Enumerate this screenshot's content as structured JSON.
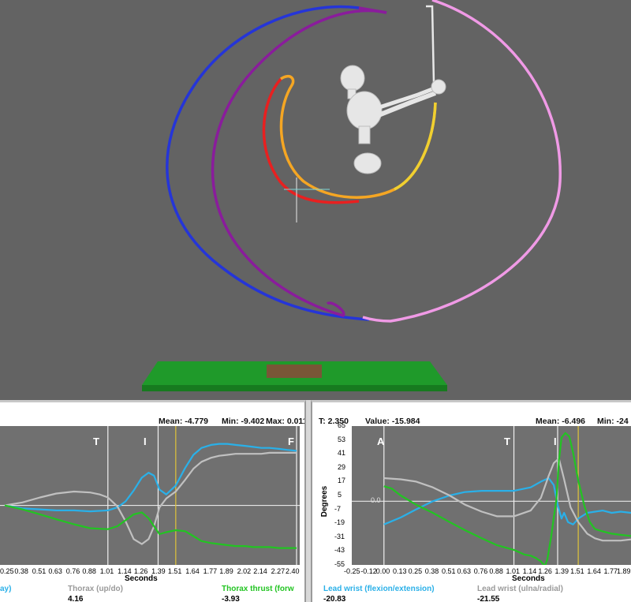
{
  "scene": {
    "colors": {
      "background": "#636363",
      "blue": "#2535d8",
      "purple": "#8a1c9c",
      "pink": "#f09ae6",
      "red": "#e82020",
      "orange": "#f5a623",
      "yellow": "#f0d030",
      "mat": "#1f9a2a"
    }
  },
  "left_panel": {
    "stats": {
      "mean": "Mean: -4.779",
      "min": "Min: -9.402",
      "max": "Max: 0.011"
    },
    "event_labels": [
      "T",
      "I",
      "F"
    ],
    "legend": [
      {
        "label": "ay)",
        "value": "",
        "color": "#2ab0e8"
      },
      {
        "label": "Thorax (up/do)",
        "value": "4.16",
        "color": "#9a9a9a"
      },
      {
        "label": "Thorax thrust (forw",
        "value": "-3.93",
        "color": "#22c422"
      }
    ]
  },
  "right_panel": {
    "header": {
      "time": "T: 2.350",
      "value": "Value: -15.984",
      "mean": "Mean: -6.496",
      "min": "Min: -24"
    },
    "event_labels": [
      "A",
      "T",
      "I"
    ],
    "zero_label": "0.0",
    "legend": [
      {
        "label": "Lead wrist (flexion/extension)",
        "value": "-20.83",
        "color": "#2ab0e8"
      },
      {
        "label": "Lead wrist (ulna/radial)",
        "value": "-21.55",
        "color": "#9a9a9a"
      }
    ]
  },
  "chart_data": [
    {
      "type": "line",
      "title": "",
      "xlabel": "Seconds",
      "ylabel": "",
      "x_ticks": [
        "0.25",
        "0.38",
        "0.51",
        "0.63",
        "0.76",
        "0.88",
        "1.01",
        "1.14",
        "1.26",
        "1.39",
        "1.51",
        "1.64",
        "1.77",
        "1.89",
        "2.02",
        "2.14",
        "2.27",
        "2.40"
      ],
      "xlim": [
        0.25,
        2.4
      ],
      "ylim": [
        -12,
        2
      ],
      "events": [
        {
          "label": "T",
          "x": 1.01
        },
        {
          "label": "I",
          "x": 1.38
        },
        {
          "label": "F",
          "x": 2.4
        }
      ],
      "cursor_x": 1.51,
      "series": [
        {
          "name": "",
          "color": "#2ab0e8",
          "x": [
            0.25,
            0.38,
            0.51,
            0.63,
            0.76,
            0.88,
            1.01,
            1.08,
            1.14,
            1.2,
            1.26,
            1.31,
            1.35,
            1.39,
            1.44,
            1.51,
            1.58,
            1.64,
            1.7,
            1.77,
            1.83,
            1.89,
            1.95,
            2.02,
            2.08,
            2.14,
            2.2,
            2.27,
            2.33,
            2.4
          ],
          "y": [
            -6.0,
            -6.3,
            -6.4,
            -6.5,
            -6.5,
            -6.6,
            -6.5,
            -6.2,
            -5.6,
            -4.5,
            -3.2,
            -2.7,
            -3.0,
            -4.4,
            -4.9,
            -4.0,
            -2.2,
            -0.9,
            -0.2,
            0.1,
            0.2,
            0.2,
            0.1,
            0.0,
            -0.1,
            -0.2,
            -0.2,
            -0.3,
            -0.4,
            -0.5
          ]
        },
        {
          "name": "Thorax (up/do)",
          "color": "#c0c0c0",
          "x": [
            0.25,
            0.38,
            0.51,
            0.63,
            0.76,
            0.88,
            0.95,
            1.01,
            1.08,
            1.14,
            1.2,
            1.26,
            1.31,
            1.35,
            1.39,
            1.44,
            1.51,
            1.58,
            1.64,
            1.7,
            1.77,
            1.83,
            1.89,
            1.95,
            2.02,
            2.08,
            2.14,
            2.2,
            2.27,
            2.33,
            2.4
          ],
          "y": [
            -6.0,
            -5.7,
            -5.2,
            -4.8,
            -4.6,
            -4.7,
            -4.9,
            -5.2,
            -6.1,
            -7.6,
            -9.4,
            -9.9,
            -9.4,
            -8.1,
            -6.2,
            -5.3,
            -4.6,
            -3.4,
            -2.3,
            -1.6,
            -1.2,
            -1.0,
            -0.9,
            -0.8,
            -0.8,
            -0.8,
            -0.8,
            -0.7,
            -0.7,
            -0.7,
            -0.7
          ]
        },
        {
          "name": "Thorax thrust (forw",
          "color": "#22c422",
          "x": [
            0.25,
            0.38,
            0.51,
            0.63,
            0.76,
            0.88,
            1.01,
            1.08,
            1.14,
            1.2,
            1.26,
            1.31,
            1.35,
            1.39,
            1.44,
            1.51,
            1.58,
            1.64,
            1.7,
            1.77,
            1.83,
            1.89,
            1.95,
            2.02,
            2.08,
            2.14,
            2.2,
            2.27,
            2.33,
            2.4
          ],
          "y": [
            -6.0,
            -6.4,
            -6.9,
            -7.4,
            -7.9,
            -8.3,
            -8.4,
            -8.1,
            -7.5,
            -6.9,
            -6.7,
            -7.3,
            -8.1,
            -8.9,
            -8.7,
            -8.5,
            -8.6,
            -9.1,
            -9.6,
            -9.8,
            -9.9,
            -10.0,
            -10.1,
            -10.1,
            -10.2,
            -10.2,
            -10.2,
            -10.3,
            -10.3,
            -10.3
          ]
        }
      ]
    },
    {
      "type": "line",
      "title": "",
      "xlabel": "Seconds",
      "ylabel": "Degrees",
      "x_ticks": [
        "-0.25",
        "-0.12",
        "0.00",
        "0.13",
        "0.25",
        "0.38",
        "0.51",
        "0.63",
        "0.76",
        "0.88",
        "1.01",
        "1.14",
        "1.26",
        "1.39",
        "1.51",
        "1.64",
        "1.77",
        "1.89"
      ],
      "y_ticks": [
        65,
        53,
        41,
        29,
        17,
        5,
        -7,
        -19,
        -31,
        -43,
        -55
      ],
      "xlim": [
        -0.25,
        1.92
      ],
      "ylim": [
        -55,
        65
      ],
      "events": [
        {
          "label": "A",
          "x": 0.0
        },
        {
          "label": "T",
          "x": 1.01
        },
        {
          "label": "I",
          "x": 1.35
        }
      ],
      "cursor_x": 1.51,
      "series": [
        {
          "name": "Lead wrist (flexion/extension)",
          "color": "#2ab0e8",
          "x": [
            0.0,
            0.13,
            0.25,
            0.38,
            0.51,
            0.63,
            0.76,
            0.88,
            1.01,
            1.14,
            1.22,
            1.28,
            1.32,
            1.35,
            1.38,
            1.4,
            1.43,
            1.47,
            1.51,
            1.58,
            1.64,
            1.7,
            1.77,
            1.84,
            1.92
          ],
          "y": [
            -20,
            -14,
            -7,
            0,
            5,
            8,
            9,
            9,
            9,
            12,
            17,
            20,
            14,
            -3,
            -15,
            -10,
            -18,
            -20,
            -15,
            -10,
            -9,
            -8,
            -10,
            -9,
            -10
          ]
        },
        {
          "name": "Lead wrist (ulna/radial)",
          "color": "#c0c0c0",
          "x": [
            0.0,
            0.13,
            0.25,
            0.38,
            0.51,
            0.63,
            0.76,
            0.88,
            1.01,
            1.14,
            1.22,
            1.28,
            1.32,
            1.36,
            1.4,
            1.45,
            1.51,
            1.58,
            1.64,
            1.7,
            1.77,
            1.84,
            1.92
          ],
          "y": [
            20,
            19,
            17,
            12,
            5,
            -3,
            -9,
            -13,
            -13,
            -8,
            3,
            22,
            33,
            37,
            19,
            -5,
            -18,
            -28,
            -32,
            -34,
            -34,
            -34,
            -33
          ]
        },
        {
          "name": "",
          "color": "#22c422",
          "x": [
            0.0,
            0.06,
            0.13,
            0.25,
            0.38,
            0.51,
            0.63,
            0.76,
            0.88,
            1.01,
            1.09,
            1.14,
            1.18,
            1.22,
            1.25,
            1.27,
            1.3,
            1.32,
            1.34,
            1.36,
            1.38,
            1.41,
            1.44,
            1.47,
            1.51,
            1.56,
            1.6,
            1.64,
            1.7,
            1.77,
            1.84,
            1.92
          ],
          "y": [
            13,
            11,
            5,
            -3,
            -10,
            -18,
            -25,
            -32,
            -38,
            -42,
            -46,
            -47,
            -49,
            -52,
            -56,
            -50,
            -30,
            -14,
            1,
            35,
            55,
            59,
            56,
            42,
            18,
            -5,
            -18,
            -24,
            -26,
            -28,
            -29,
            -30
          ]
        }
      ]
    }
  ]
}
